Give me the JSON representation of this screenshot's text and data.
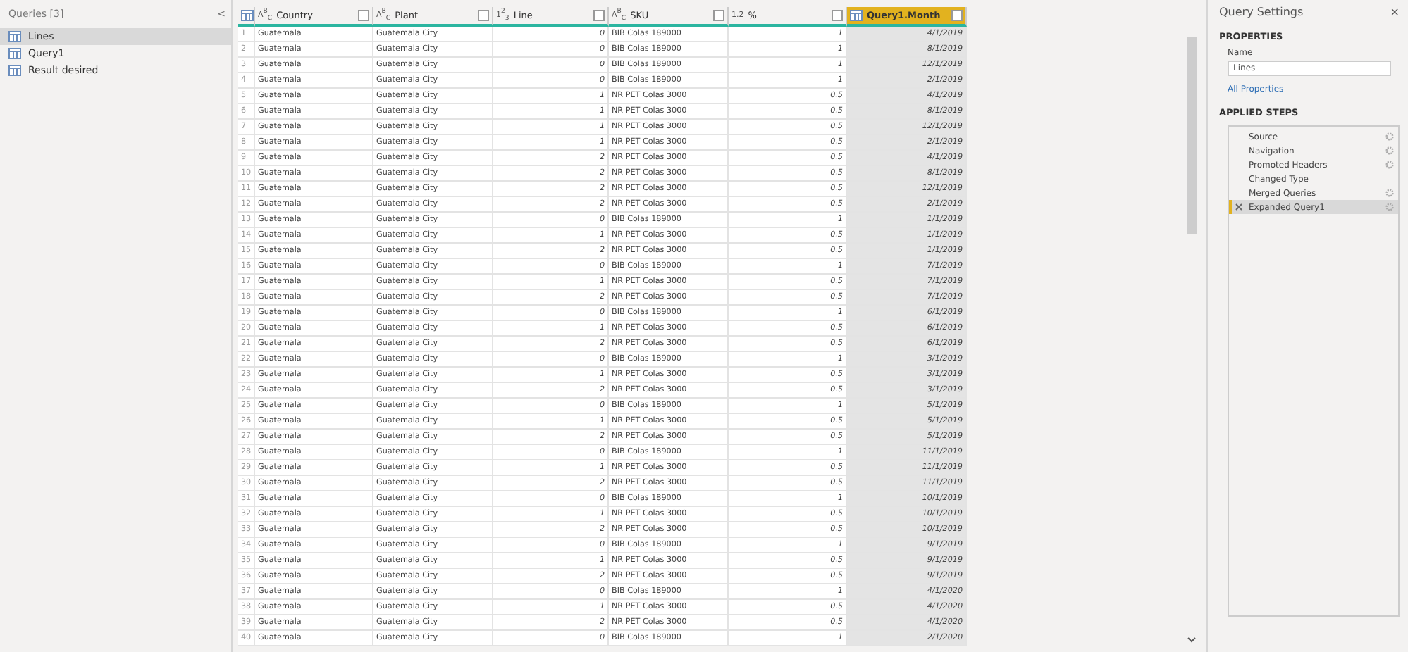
{
  "queries_pane": {
    "title": "Queries [3]",
    "collapse": "<",
    "items": [
      {
        "label": "Lines",
        "selected": true
      },
      {
        "label": "Query1",
        "selected": false
      },
      {
        "label": "Result desired",
        "selected": false
      }
    ]
  },
  "table": {
    "columns": [
      {
        "kind": "index",
        "selected": false
      },
      {
        "name": "Country",
        "type": "A$^{B}$$_{C}$",
        "kind": "text",
        "selected": false
      },
      {
        "name": "Plant",
        "type": "A$^{B}$$_{C}$",
        "kind": "text",
        "selected": false
      },
      {
        "name": "Line",
        "type": "1$^{2}$$_{3}$",
        "kind": "number",
        "selected": false
      },
      {
        "name": "SKU",
        "type": "A$^{B}$$_{C}$",
        "kind": "text",
        "selected": false
      },
      {
        "name": "%",
        "type": "1.2",
        "kind": "number",
        "selected": false
      },
      {
        "name": "Query1.Month",
        "kind": "table",
        "selected": true
      }
    ],
    "rows": [
      [
        "1",
        "Guatemala",
        "Guatemala City",
        "0",
        "BIB Colas 189000",
        "1",
        "4/1/2019"
      ],
      [
        "2",
        "Guatemala",
        "Guatemala City",
        "0",
        "BIB Colas 189000",
        "1",
        "8/1/2019"
      ],
      [
        "3",
        "Guatemala",
        "Guatemala City",
        "0",
        "BIB Colas 189000",
        "1",
        "12/1/2019"
      ],
      [
        "4",
        "Guatemala",
        "Guatemala City",
        "0",
        "BIB Colas 189000",
        "1",
        "2/1/2019"
      ],
      [
        "5",
        "Guatemala",
        "Guatemala City",
        "1",
        "NR PET Colas 3000",
        "0.5",
        "4/1/2019"
      ],
      [
        "6",
        "Guatemala",
        "Guatemala City",
        "1",
        "NR PET Colas 3000",
        "0.5",
        "8/1/2019"
      ],
      [
        "7",
        "Guatemala",
        "Guatemala City",
        "1",
        "NR PET Colas 3000",
        "0.5",
        "12/1/2019"
      ],
      [
        "8",
        "Guatemala",
        "Guatemala City",
        "1",
        "NR PET Colas 3000",
        "0.5",
        "2/1/2019"
      ],
      [
        "9",
        "Guatemala",
        "Guatemala City",
        "2",
        "NR PET Colas 3000",
        "0.5",
        "4/1/2019"
      ],
      [
        "10",
        "Guatemala",
        "Guatemala City",
        "2",
        "NR PET Colas 3000",
        "0.5",
        "8/1/2019"
      ],
      [
        "11",
        "Guatemala",
        "Guatemala City",
        "2",
        "NR PET Colas 3000",
        "0.5",
        "12/1/2019"
      ],
      [
        "12",
        "Guatemala",
        "Guatemala City",
        "2",
        "NR PET Colas 3000",
        "0.5",
        "2/1/2019"
      ],
      [
        "13",
        "Guatemala",
        "Guatemala City",
        "0",
        "BIB Colas 189000",
        "1",
        "1/1/2019"
      ],
      [
        "14",
        "Guatemala",
        "Guatemala City",
        "1",
        "NR PET Colas 3000",
        "0.5",
        "1/1/2019"
      ],
      [
        "15",
        "Guatemala",
        "Guatemala City",
        "2",
        "NR PET Colas 3000",
        "0.5",
        "1/1/2019"
      ],
      [
        "16",
        "Guatemala",
        "Guatemala City",
        "0",
        "BIB Colas 189000",
        "1",
        "7/1/2019"
      ],
      [
        "17",
        "Guatemala",
        "Guatemala City",
        "1",
        "NR PET Colas 3000",
        "0.5",
        "7/1/2019"
      ],
      [
        "18",
        "Guatemala",
        "Guatemala City",
        "2",
        "NR PET Colas 3000",
        "0.5",
        "7/1/2019"
      ],
      [
        "19",
        "Guatemala",
        "Guatemala City",
        "0",
        "BIB Colas 189000",
        "1",
        "6/1/2019"
      ],
      [
        "20",
        "Guatemala",
        "Guatemala City",
        "1",
        "NR PET Colas 3000",
        "0.5",
        "6/1/2019"
      ],
      [
        "21",
        "Guatemala",
        "Guatemala City",
        "2",
        "NR PET Colas 3000",
        "0.5",
        "6/1/2019"
      ],
      [
        "22",
        "Guatemala",
        "Guatemala City",
        "0",
        "BIB Colas 189000",
        "1",
        "3/1/2019"
      ],
      [
        "23",
        "Guatemala",
        "Guatemala City",
        "1",
        "NR PET Colas 3000",
        "0.5",
        "3/1/2019"
      ],
      [
        "24",
        "Guatemala",
        "Guatemala City",
        "2",
        "NR PET Colas 3000",
        "0.5",
        "3/1/2019"
      ],
      [
        "25",
        "Guatemala",
        "Guatemala City",
        "0",
        "BIB Colas 189000",
        "1",
        "5/1/2019"
      ],
      [
        "26",
        "Guatemala",
        "Guatemala City",
        "1",
        "NR PET Colas 3000",
        "0.5",
        "5/1/2019"
      ],
      [
        "27",
        "Guatemala",
        "Guatemala City",
        "2",
        "NR PET Colas 3000",
        "0.5",
        "5/1/2019"
      ],
      [
        "28",
        "Guatemala",
        "Guatemala City",
        "0",
        "BIB Colas 189000",
        "1",
        "11/1/2019"
      ],
      [
        "29",
        "Guatemala",
        "Guatemala City",
        "1",
        "NR PET Colas 3000",
        "0.5",
        "11/1/2019"
      ],
      [
        "30",
        "Guatemala",
        "Guatemala City",
        "2",
        "NR PET Colas 3000",
        "0.5",
        "11/1/2019"
      ],
      [
        "31",
        "Guatemala",
        "Guatemala City",
        "0",
        "BIB Colas 189000",
        "1",
        "10/1/2019"
      ],
      [
        "32",
        "Guatemala",
        "Guatemala City",
        "1",
        "NR PET Colas 3000",
        "0.5",
        "10/1/2019"
      ],
      [
        "33",
        "Guatemala",
        "Guatemala City",
        "2",
        "NR PET Colas 3000",
        "0.5",
        "10/1/2019"
      ],
      [
        "34",
        "Guatemala",
        "Guatemala City",
        "0",
        "BIB Colas 189000",
        "1",
        "9/1/2019"
      ],
      [
        "35",
        "Guatemala",
        "Guatemala City",
        "1",
        "NR PET Colas 3000",
        "0.5",
        "9/1/2019"
      ],
      [
        "36",
        "Guatemala",
        "Guatemala City",
        "2",
        "NR PET Colas 3000",
        "0.5",
        "9/1/2019"
      ],
      [
        "37",
        "Guatemala",
        "Guatemala City",
        "0",
        "BIB Colas 189000",
        "1",
        "4/1/2020"
      ],
      [
        "38",
        "Guatemala",
        "Guatemala City",
        "1",
        "NR PET Colas 3000",
        "0.5",
        "4/1/2020"
      ],
      [
        "39",
        "Guatemala",
        "Guatemala City",
        "2",
        "NR PET Colas 3000",
        "0.5",
        "4/1/2020"
      ],
      [
        "40",
        "Guatemala",
        "Guatemala City",
        "0",
        "BIB Colas 189000",
        "1",
        "2/1/2020"
      ]
    ]
  },
  "query_settings": {
    "title": "Query Settings",
    "close": "×",
    "properties": {
      "heading": "PROPERTIES",
      "name_label": "Name",
      "name_value": "Lines",
      "link": "All Properties"
    },
    "applied_steps": {
      "heading": "APPLIED STEPS",
      "steps": [
        {
          "label": "Source",
          "gear": true,
          "selected": false
        },
        {
          "label": "Navigation",
          "gear": true,
          "selected": false
        },
        {
          "label": "Promoted Headers",
          "gear": true,
          "selected": false
        },
        {
          "label": "Changed Type",
          "gear": false,
          "selected": false
        },
        {
          "label": "Merged Queries",
          "gear": true,
          "selected": false
        },
        {
          "label": "Expanded Query1",
          "gear": true,
          "selected": true
        }
      ]
    }
  }
}
